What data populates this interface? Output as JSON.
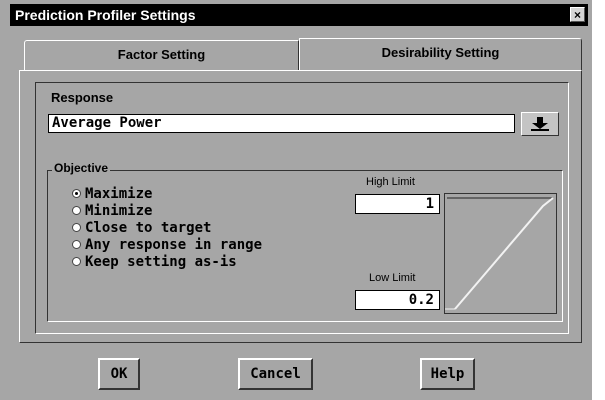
{
  "window": {
    "title": "Prediction Profiler Settings",
    "close_label": "×"
  },
  "tabs": [
    {
      "label": "Factor Setting",
      "active": false
    },
    {
      "label": "Desirability Setting",
      "active": true
    }
  ],
  "response": {
    "label": "Response",
    "value": "Average Power",
    "button_icon": "arrow-down-icon"
  },
  "objective": {
    "label": "Objective",
    "options": [
      {
        "label": "Maximize",
        "selected": true
      },
      {
        "label": "Minimize",
        "selected": false
      },
      {
        "label": "Close to target",
        "selected": false
      },
      {
        "label": "Any response in range",
        "selected": false
      },
      {
        "label": "Keep setting as-is",
        "selected": false
      }
    ],
    "high_limit_label": "High Limit",
    "high_limit_value": "1",
    "low_limit_label": "Low Limit",
    "low_limit_value": "0.2"
  },
  "buttons": {
    "ok": "OK",
    "cancel": "Cancel",
    "help": "Help"
  },
  "colors": {
    "dialog_bg": "#a6a6a6",
    "titlebar_bg": "#000000",
    "field_bg": "#ffffff"
  }
}
